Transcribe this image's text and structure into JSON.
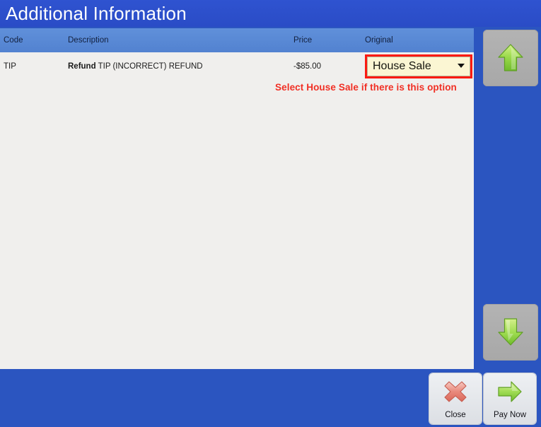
{
  "window": {
    "title": "Additional Information"
  },
  "grid": {
    "columns": [
      {
        "key": "code",
        "label": "Code"
      },
      {
        "key": "description",
        "label": "Description"
      },
      {
        "key": "price",
        "label": "Price"
      },
      {
        "key": "original",
        "label": "Original"
      }
    ],
    "rows": [
      {
        "code": "TIP",
        "description_bold": "Refund",
        "description_rest": " TIP (INCORRECT) REFUND",
        "price": "-$85.00",
        "original_value": "House Sale"
      }
    ]
  },
  "annotation": {
    "text": "Select House Sale if there is this option",
    "color": "#f12f24"
  },
  "scroll": {
    "up_icon": "arrow-up-icon",
    "down_icon": "arrow-down-icon"
  },
  "footer": {
    "buttons": [
      {
        "label": "Close",
        "icon": "close-cross-icon"
      },
      {
        "label": "Pay Now",
        "icon": "arrow-right-icon"
      }
    ]
  },
  "colors": {
    "title_bar": "#2a4fcd",
    "footer": "#2b55c0",
    "grid_header": "#5b8ad6",
    "grid_body": "#f0efed",
    "dropdown_bg": "#fbf6d3",
    "highlight_border": "#fb1a11",
    "accent_green": "#7ac943"
  }
}
